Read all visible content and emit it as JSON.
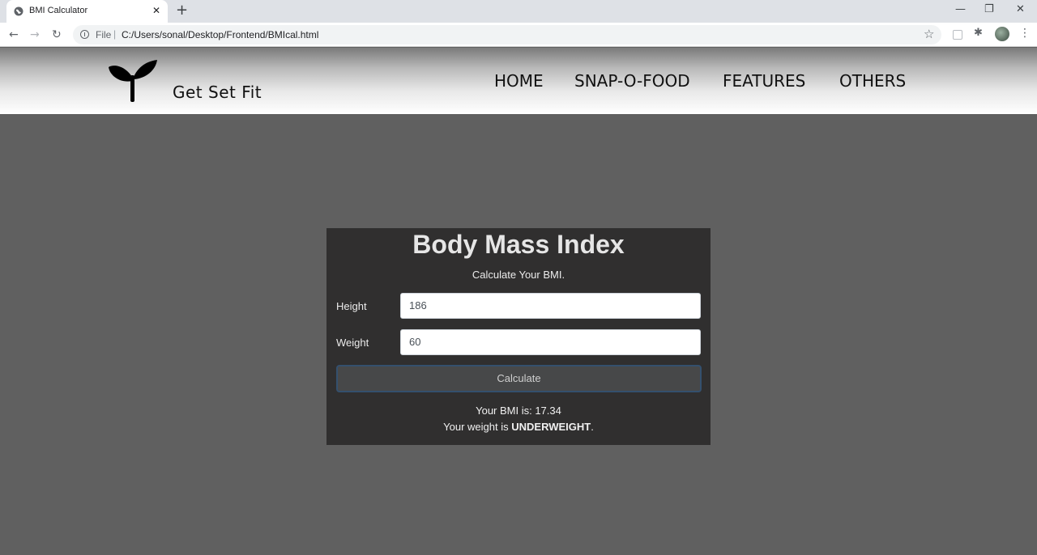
{
  "browser": {
    "tab_title": "BMI Calculator",
    "tab_favicon": "globe-icon",
    "tab_close": "✕",
    "new_tab": "+",
    "window_buttons": {
      "minimize": "—",
      "restore": "❐",
      "close": "✕"
    },
    "url_scheme": "File",
    "url_separator": "|",
    "url": "C:/Users/sonal/Desktop/Frontend/BMIcal.html"
  },
  "header": {
    "brand": "Get Set Fit",
    "logo_icon": "sprout-icon",
    "nav": [
      "HOME",
      "SNAP-O-FOOD",
      "FEATURES",
      "OTHERS"
    ]
  },
  "bmi_card": {
    "title": "Body Mass Index",
    "subtitle": "Calculate Your BMI.",
    "height_label": "Height",
    "height_value": "186",
    "weight_label": "Weight",
    "weight_value": "60",
    "calculate_label": "Calculate",
    "result_prefix": "Your BMI is: ",
    "bmi_value": "17.34",
    "status_prefix": "Your weight is ",
    "status_value": "UNDERWEIGHT",
    "status_suffix": "."
  },
  "colors": {
    "page_background": "#606060",
    "card_background": "#302f2f",
    "button_background": "#474849",
    "button_border": "#34506e"
  }
}
